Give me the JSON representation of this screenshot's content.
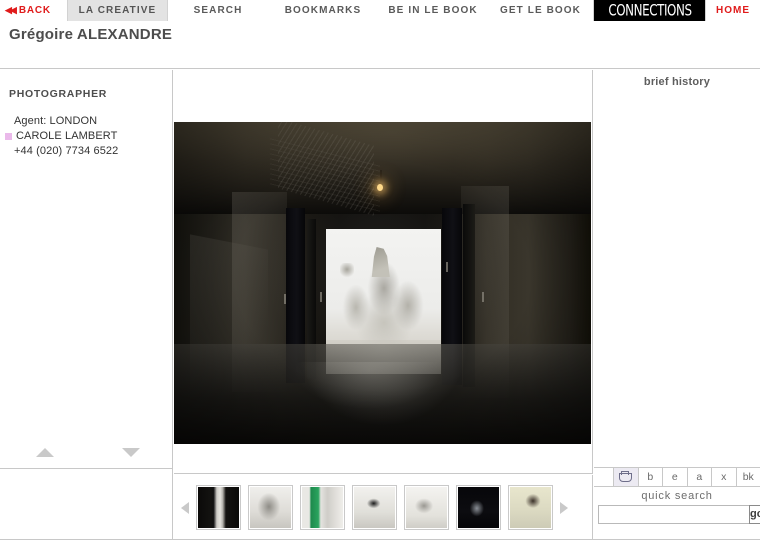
{
  "nav": {
    "back": {
      "label": "BACK",
      "icon": "double-left-arrow-icon"
    },
    "items": [
      {
        "label": "LA CREATIVE",
        "active": true
      },
      {
        "label": "SEARCH",
        "active": false
      },
      {
        "label": "BOOKMARKS",
        "active": false
      },
      {
        "label": "BE IN LE BOOK",
        "active": false
      },
      {
        "label": "GET LE BOOK",
        "active": false
      }
    ],
    "connections": {
      "label": "CONNECTIONS"
    },
    "home": {
      "label": "HOME"
    }
  },
  "header": {
    "title": "Grégoire ALEXANDRE"
  },
  "sidebar": {
    "role_label": "PHOTOGRAPHER",
    "agent_label": "Agent: LONDON",
    "agent_name": "CAROLE LAMBERT",
    "agent_phone": "+44 (020) 7734 6522",
    "bullet_color": "#eab9ea",
    "scroll_up_icon": "triangle-up-icon",
    "scroll_down_icon": "triangle-down-icon"
  },
  "main": {
    "photo_alt": "Dark concrete corridor with open doors revealing a bright white rocky landscape"
  },
  "thumbnails": {
    "prev_icon": "triangle-left-icon",
    "next_icon": "triangle-right-icon",
    "items": [
      {
        "name": "dark-corridor-thumb",
        "selected": true
      },
      {
        "name": "white-sculpture-thumb",
        "selected": false
      },
      {
        "name": "green-backdrop-thumb",
        "selected": false
      },
      {
        "name": "figure-on-table-thumb",
        "selected": false
      },
      {
        "name": "wire-structure-thumb",
        "selected": false
      },
      {
        "name": "dark-figure-thumb",
        "selected": false
      },
      {
        "name": "beige-still-life-thumb",
        "selected": false
      }
    ]
  },
  "right": {
    "brief_history": "brief history",
    "letter_buttons": [
      {
        "label": "",
        "icon": "folder-icon",
        "highlighted": true
      },
      {
        "label": "b",
        "icon": "",
        "highlighted": false
      },
      {
        "label": "e",
        "icon": "",
        "highlighted": false
      },
      {
        "label": "a",
        "icon": "",
        "highlighted": false
      },
      {
        "label": "x",
        "icon": "",
        "highlighted": false
      },
      {
        "label": "bk",
        "icon": "",
        "highlighted": false
      }
    ],
    "quick_search_label": "quick search",
    "quick_search_value": "",
    "quick_search_placeholder": "",
    "go_label": "go"
  }
}
